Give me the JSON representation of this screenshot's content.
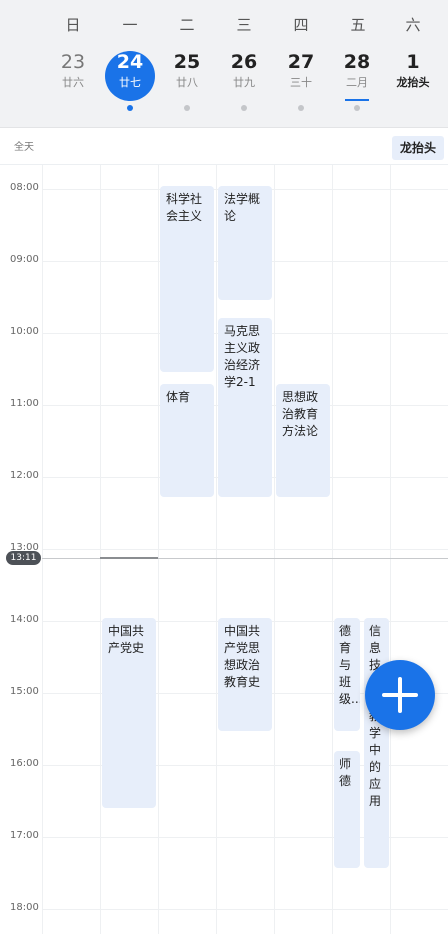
{
  "weekdays": [
    "日",
    "一",
    "二",
    "三",
    "四",
    "五",
    "六"
  ],
  "days": [
    {
      "num": "23",
      "lunar": "廿六"
    },
    {
      "num": "24",
      "lunar": "廿七"
    },
    {
      "num": "25",
      "lunar": "廿八"
    },
    {
      "num": "26",
      "lunar": "廿九"
    },
    {
      "num": "27",
      "lunar": "三十"
    },
    {
      "num": "28",
      "lunar": "二月"
    },
    {
      "num": "1",
      "lunar": "龙抬头"
    }
  ],
  "allday": {
    "label": "全天",
    "event": "龙抬头"
  },
  "times": [
    "08:00",
    "09:00",
    "10:00",
    "11:00",
    "12:00",
    "13:00",
    "14:00",
    "15:00",
    "16:00",
    "17:00",
    "18:00"
  ],
  "now": "13:11",
  "events": {
    "kexue": "科学社会主义",
    "faxue": "法学概论",
    "makesi": "马克思主义政治经济学2-1",
    "tiyu": "体育",
    "sixiang": "思想政治教育方法论",
    "dangshi": "中国共产党史",
    "zhengzhi": "中国共产党思想政治教育史",
    "deyu": "德育与班级...",
    "xinxi": "信息技术在教学中的应用",
    "shide": "师德"
  },
  "colors": {
    "accent": "#1a73e8",
    "event_bg": "#e7eefa"
  }
}
